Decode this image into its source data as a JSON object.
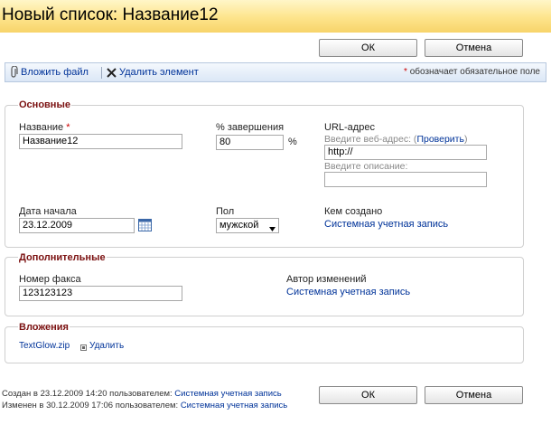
{
  "window": {
    "title": "Новый список: Название12"
  },
  "buttons": {
    "ok": "ОК",
    "cancel": "Отмена"
  },
  "toolbar": {
    "attach": "Вложить файл",
    "delete": "Удалить элемент",
    "required_mark": "*",
    "required_note": " обозначает обязательное поле"
  },
  "main": {
    "title": "Основные",
    "name_label": "Название",
    "name_value": "Название12",
    "pct_label": "% завершения",
    "pct_value": "80",
    "pct_unit": "%",
    "url_label": "URL-адрес",
    "url_hint_prefix": "Введите веб-адрес: (",
    "url_check": "Проверить",
    "url_hint_suffix": ")",
    "url_value": "http://",
    "desc_hint": "Введите описание:",
    "desc_value": "",
    "start_label": "Дата начала",
    "start_value": "23.12.2009",
    "gender_label": "Пол",
    "gender_value": "мужской",
    "created_by_label": "Кем создано",
    "created_by_value": "Системная учетная запись"
  },
  "additional": {
    "title": "Дополнительные",
    "fax_label": "Номер факса",
    "fax_value": "123123123",
    "author_label": "Автор изменений",
    "author_value": "Системная учетная запись"
  },
  "attachments": {
    "title": "Вложения",
    "file": "TextGlow.zip",
    "delete": "Удалить"
  },
  "footer": {
    "created_prefix": "Создан в 23.12.2009 14:20  пользователем: ",
    "created_user": "Системная учетная запись",
    "modified_prefix": "Изменен в 30.12.2009 17:06  пользователем: ",
    "modified_user": "Системная учетная запись"
  },
  "colors": {
    "title_bg": "#fde48b",
    "link": "#003399",
    "section": "#7a1010",
    "required": "#cc0000"
  },
  "icons": [
    "paperclip-icon",
    "delete-x-icon",
    "calendar-icon",
    "remove-square-icon",
    "dropdown-arrow-icon"
  ]
}
